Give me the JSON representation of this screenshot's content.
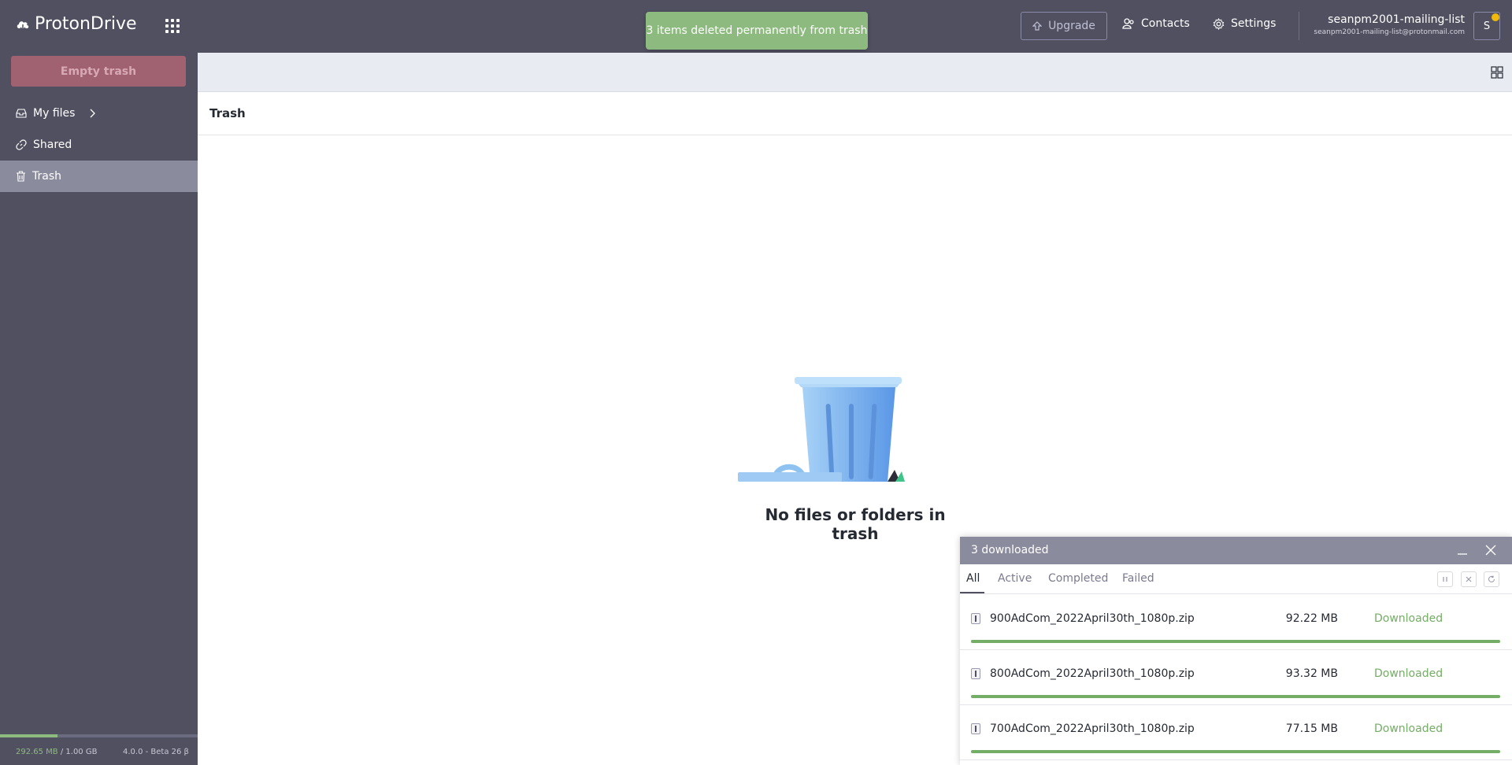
{
  "app": {
    "logo_text": "ProtonDrive"
  },
  "toast": {
    "message": "3 items deleted permanently from trash"
  },
  "header": {
    "upgrade_label": "Upgrade",
    "contacts_label": "Contacts",
    "settings_label": "Settings",
    "user_name": "seanpm2001-mailing-list",
    "user_email": "seanpm2001-mailing-list@protonmail.com",
    "avatar_initial": "S"
  },
  "sidebar": {
    "empty_trash_label": "Empty trash",
    "items": [
      {
        "label": "My files",
        "icon": "inbox-icon"
      },
      {
        "label": "Shared",
        "icon": "link-icon"
      },
      {
        "label": "Trash",
        "icon": "trash-icon",
        "active": true
      }
    ],
    "storage_used": "292.65 MB",
    "storage_total": " / 1.00 GB",
    "storage_fraction": 0.29,
    "version": "4.0.0 - Beta 26 β"
  },
  "main": {
    "breadcrumb": "Trash",
    "empty_message": "No files or folders in trash"
  },
  "transfers": {
    "title": "3 downloaded",
    "tabs": [
      "All",
      "Active",
      "Completed",
      "Failed"
    ],
    "active_tab": "All",
    "rows": [
      {
        "name": "900AdCom_2022April30th_1080p.zip",
        "size": "92.22 MB",
        "status": "Downloaded",
        "progress": 1.0
      },
      {
        "name": "800AdCom_2022April30th_1080p.zip",
        "size": "93.32 MB",
        "status": "Downloaded",
        "progress": 1.0
      },
      {
        "name": "700AdCom_2022April30th_1080p.zip",
        "size": "77.15 MB",
        "status": "Downloaded",
        "progress": 1.0
      }
    ]
  },
  "colors": {
    "header_bg": "#505061",
    "accent_success": "#8dba7e",
    "empty_trash_button": "#a06171"
  }
}
